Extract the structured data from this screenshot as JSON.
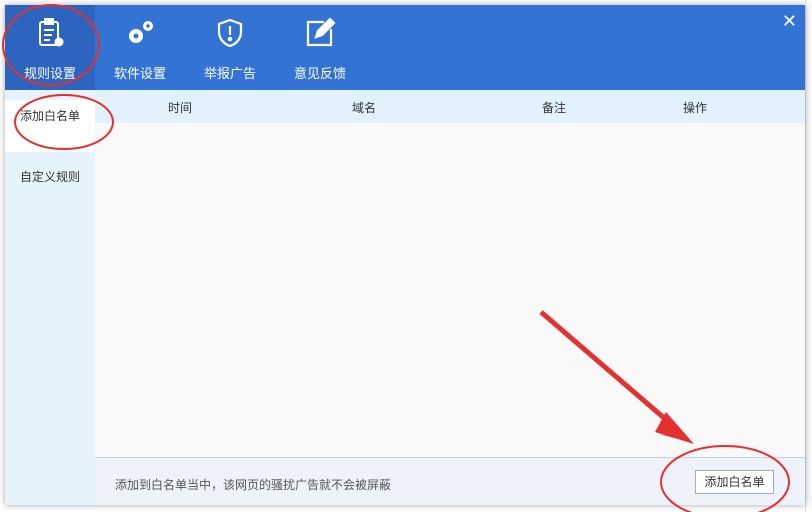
{
  "header": {
    "tabs": [
      {
        "label": "规则设置",
        "icon": "clipboard-gear-icon",
        "active": true
      },
      {
        "label": "软件设置",
        "icon": "gears-icon"
      },
      {
        "label": "举报广告",
        "icon": "shield-alert-icon"
      },
      {
        "label": "意见反馈",
        "icon": "edit-icon"
      }
    ],
    "close": "✕"
  },
  "sidebar": {
    "items": [
      {
        "label": "添加白名单",
        "active": true
      },
      {
        "label": "自定义规则"
      }
    ]
  },
  "table": {
    "columns": [
      "时间",
      "域名",
      "备注",
      "操作"
    ],
    "rows": []
  },
  "footer": {
    "note": "添加到白名单当中，该网页的骚扰广告就不会被屏蔽",
    "add_button": "添加白名单"
  },
  "colors": {
    "header": "#3373d4",
    "active_tab": "#2d64c0",
    "sidebar": "#e5f3fc",
    "annotation": "#e53030"
  }
}
